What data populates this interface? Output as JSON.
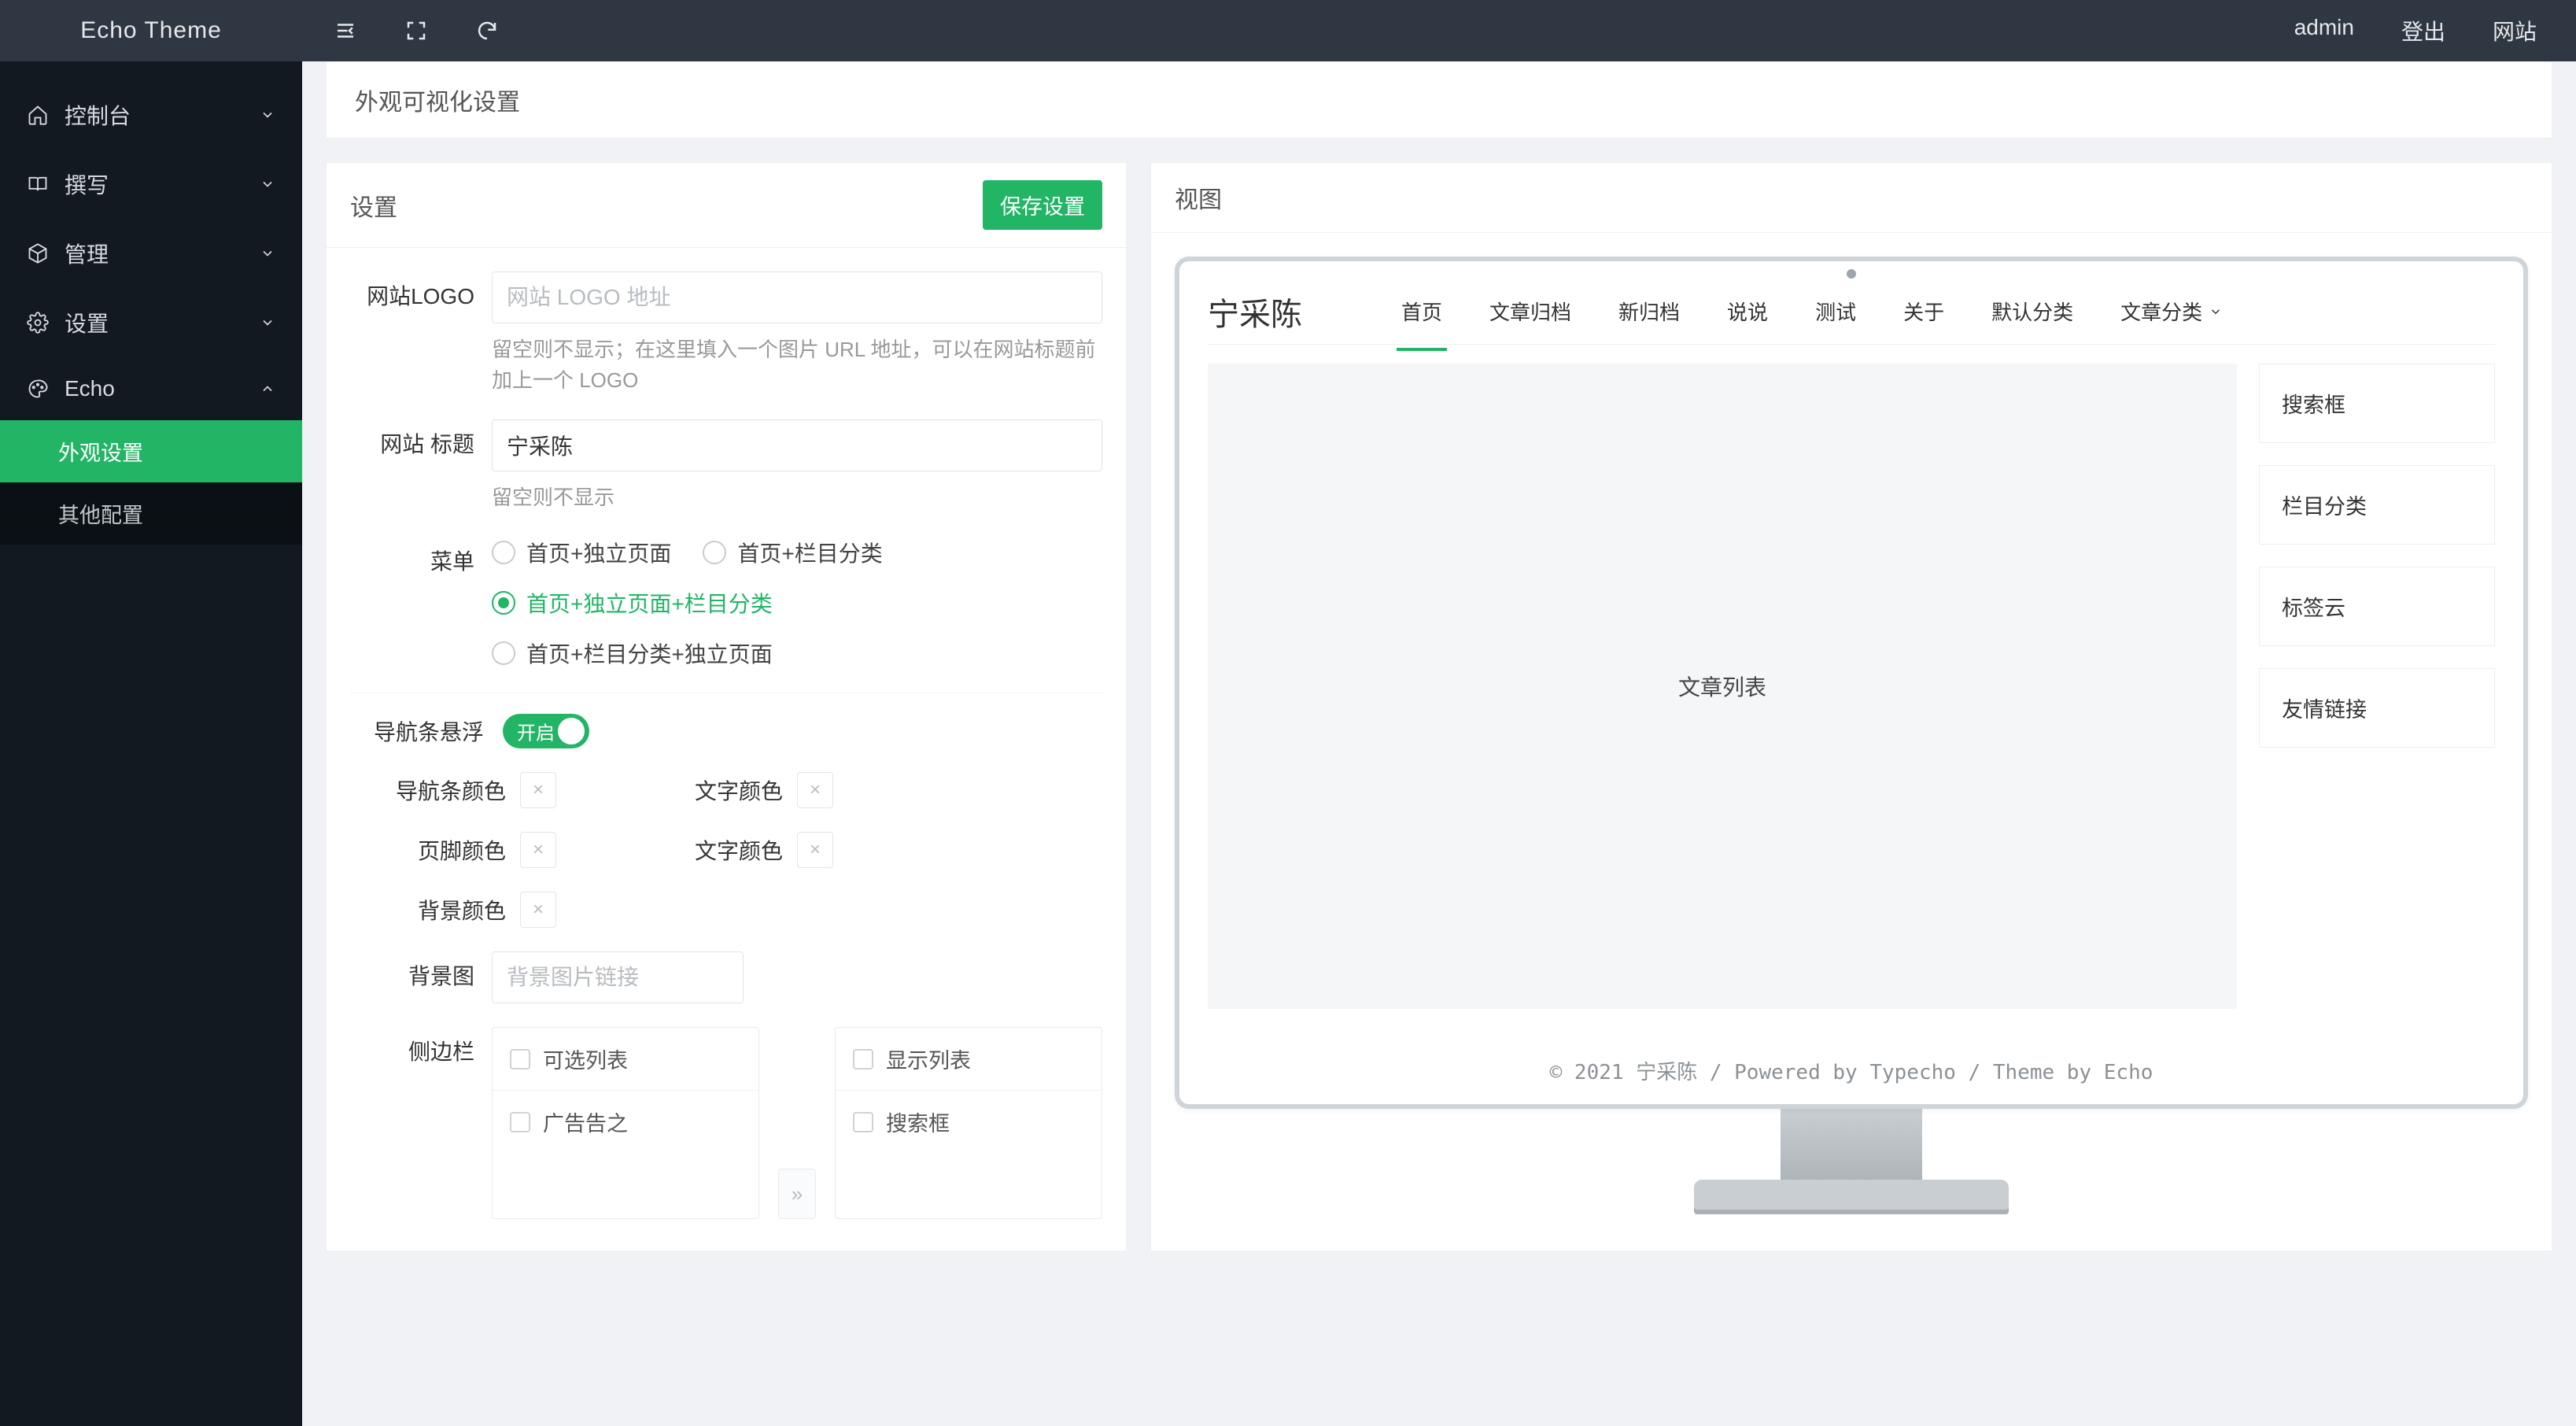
{
  "brand": "Echo Theme",
  "topRight": {
    "admin": "admin",
    "logout": "登出",
    "site": "网站"
  },
  "sidebar": {
    "items": [
      {
        "label": "控制台"
      },
      {
        "label": "撰写"
      },
      {
        "label": "管理"
      },
      {
        "label": "设置"
      },
      {
        "label": "Echo"
      }
    ],
    "sub": {
      "appearance": "外观设置",
      "other": "其他配置"
    }
  },
  "breadcrumb": "外观可视化设置",
  "settings": {
    "title": "设置",
    "save": "保存设置",
    "logoLabel": "网站LOGO",
    "logoPlaceholder": "网站 LOGO 地址",
    "logoHint": "留空则不显示；在这里填入一个图片 URL 地址，可以在网站标题前加上一个 LOGO",
    "titleLabel": "网站 标题",
    "titleValue": "宁采陈",
    "titleHint": "留空则不显示",
    "menuLabel": "菜单",
    "menuOptions": [
      "首页+独立页面",
      "首页+栏目分类",
      "首页+独立页面+栏目分类",
      "首页+栏目分类+独立页面"
    ],
    "navFloatLabel": "导航条悬浮",
    "switchOn": "开启",
    "navColor": "导航条颜色",
    "textColor": "文字颜色",
    "footerColor": "页脚颜色",
    "bgColor": "背景颜色",
    "bgImgLabel": "背景图",
    "bgImgPlaceholder": "背景图片链接",
    "sidebarLabel": "侧边栏",
    "checksLeft": [
      "可选列表",
      "广告告之"
    ],
    "checksRight": [
      "显示列表",
      "搜索框"
    ]
  },
  "view": {
    "title": "视图",
    "siteTitle": "宁采陈",
    "menu": [
      "首页",
      "文章归档",
      "新归档",
      "说说",
      "测试",
      "关于",
      "默认分类",
      "文章分类"
    ],
    "mainText": "文章列表",
    "widgets": [
      "搜索框",
      "栏目分类",
      "标签云",
      "友情链接"
    ],
    "footer": "© 2021 宁采陈 / Powered by Typecho / Theme by Echo"
  }
}
